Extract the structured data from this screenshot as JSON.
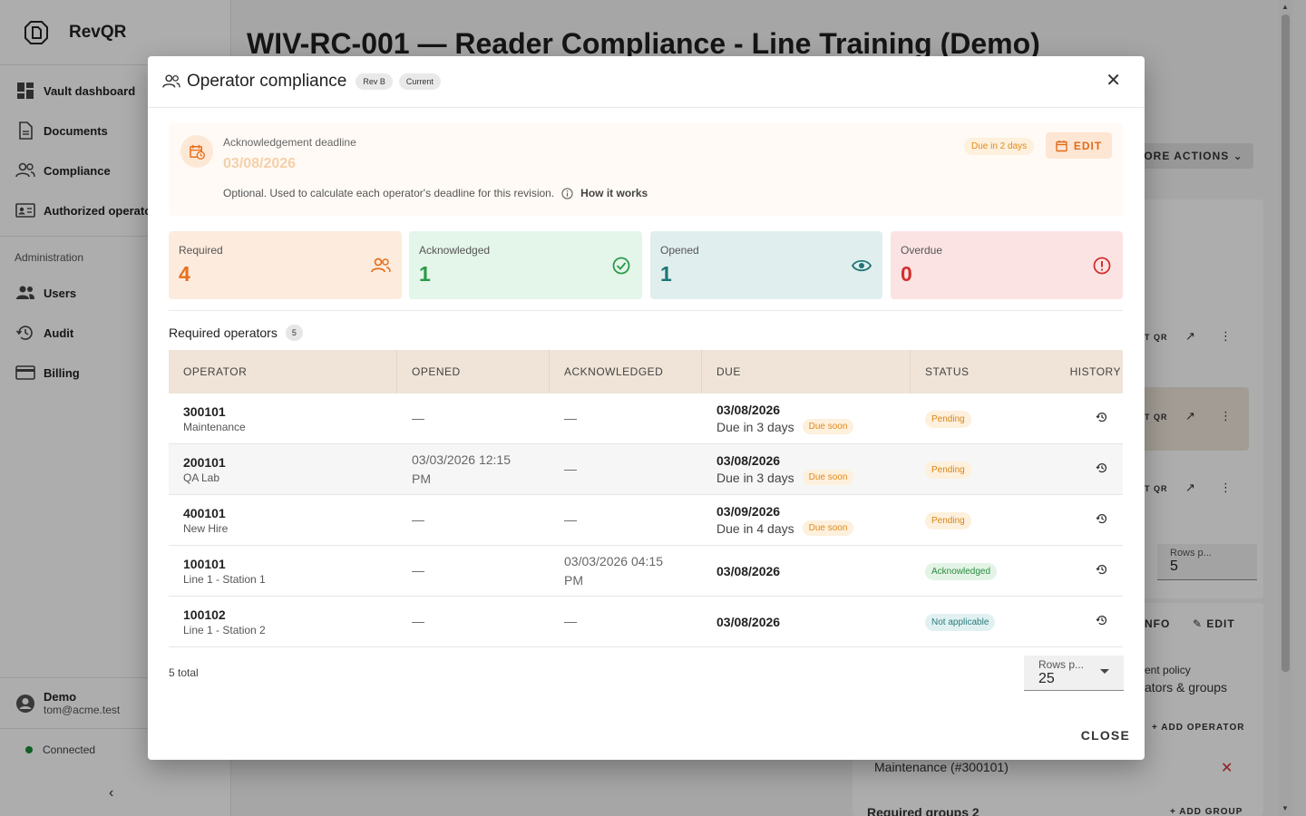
{
  "app": {
    "name": "RevQR"
  },
  "sidebar": {
    "items": [
      {
        "label": "Vault dashboard",
        "icon": "dashboard-icon"
      },
      {
        "label": "Documents",
        "icon": "document-icon"
      },
      {
        "label": "Compliance",
        "icon": "compliance-icon"
      },
      {
        "label": "Authorized operators",
        "icon": "badge-icon"
      }
    ],
    "section": "Administration",
    "admin_items": [
      {
        "label": "Users",
        "icon": "users-icon"
      },
      {
        "label": "Audit",
        "icon": "history-icon"
      },
      {
        "label": "Billing",
        "icon": "card-icon"
      }
    ],
    "user": {
      "name": "Demo",
      "email": "tom@acme.test"
    },
    "connection": "Connected",
    "collapse": "‹"
  },
  "page": {
    "title": "WIV-RC-001 — Reader Compliance - Line Training (Demo)",
    "more_actions": "ORE ACTIONS",
    "row_label": "T QR",
    "rows_per_page_label": "Rows p...",
    "rows_per_page_value": "5",
    "info_label": "NFO",
    "edit_label": "EDIT",
    "policy_text": "ent policy",
    "policy_value": "ators & groups",
    "add_operator": "ADD OPERATOR",
    "maintenance_item": "Maintenance (#300101)",
    "required_groups": "Required groups",
    "required_groups_count": "2",
    "add_group": "ADD GROUP"
  },
  "modal": {
    "title": "Operator compliance",
    "rev_chip": "Rev B",
    "current_chip": "Current",
    "deadline": {
      "label": "Acknowledgement deadline",
      "value": "03/08/2026",
      "help": "Optional. Used to calculate each operator's deadline for this revision.",
      "how_it_works": "How it works",
      "due_chip": "Due in 2 days",
      "edit": "EDIT"
    },
    "stats": [
      {
        "label": "Required",
        "value": "4",
        "bg": "#fdebdd",
        "color": "#e8701c"
      },
      {
        "label": "Acknowledged",
        "value": "1",
        "bg": "#e4f5ea",
        "color": "#2a9a47"
      },
      {
        "label": "Opened",
        "value": "1",
        "bg": "#e1eeee",
        "color": "#1f7676"
      },
      {
        "label": "Overdue",
        "value": "0",
        "bg": "#fbe3e3",
        "color": "#d32f2f"
      }
    ],
    "section_title": "Required operators",
    "section_count": "5",
    "columns": [
      "OPERATOR",
      "OPENED",
      "ACKNOWLEDGED",
      "DUE",
      "STATUS",
      "HISTORY"
    ],
    "rows": [
      {
        "id": "300101",
        "sub": "Maintenance",
        "opened": "—",
        "ack": "—",
        "due": "03/08/2026",
        "due_sub": "Due in 3 days",
        "due_chip": "Due soon",
        "status": "Pending",
        "status_type": "pending"
      },
      {
        "id": "200101",
        "sub": "QA Lab",
        "opened": "03/03/2026 12:15 PM",
        "ack": "—",
        "due": "03/08/2026",
        "due_sub": "Due in 3 days",
        "due_chip": "Due soon",
        "status": "Pending",
        "status_type": "pending"
      },
      {
        "id": "400101",
        "sub": "New Hire",
        "opened": "—",
        "ack": "—",
        "due": "03/09/2026",
        "due_sub": "Due in 4 days",
        "due_chip": "Due soon",
        "status": "Pending",
        "status_type": "pending"
      },
      {
        "id": "100101",
        "sub": "Line 1 - Station 1",
        "opened": "—",
        "ack": "03/03/2026 04:15 PM",
        "due": "03/08/2026",
        "due_sub": "",
        "due_chip": "",
        "status": "Acknowledged",
        "status_type": "ack"
      },
      {
        "id": "100102",
        "sub": "Line 1 - Station 2",
        "opened": "—",
        "ack": "—",
        "due": "03/08/2026",
        "due_sub": "",
        "due_chip": "",
        "status": "Not applicable",
        "status_type": "na"
      }
    ],
    "total": "5 total",
    "rows_per_page_label": "Rows p...",
    "rows_per_page_value": "25",
    "close": "CLOSE"
  }
}
